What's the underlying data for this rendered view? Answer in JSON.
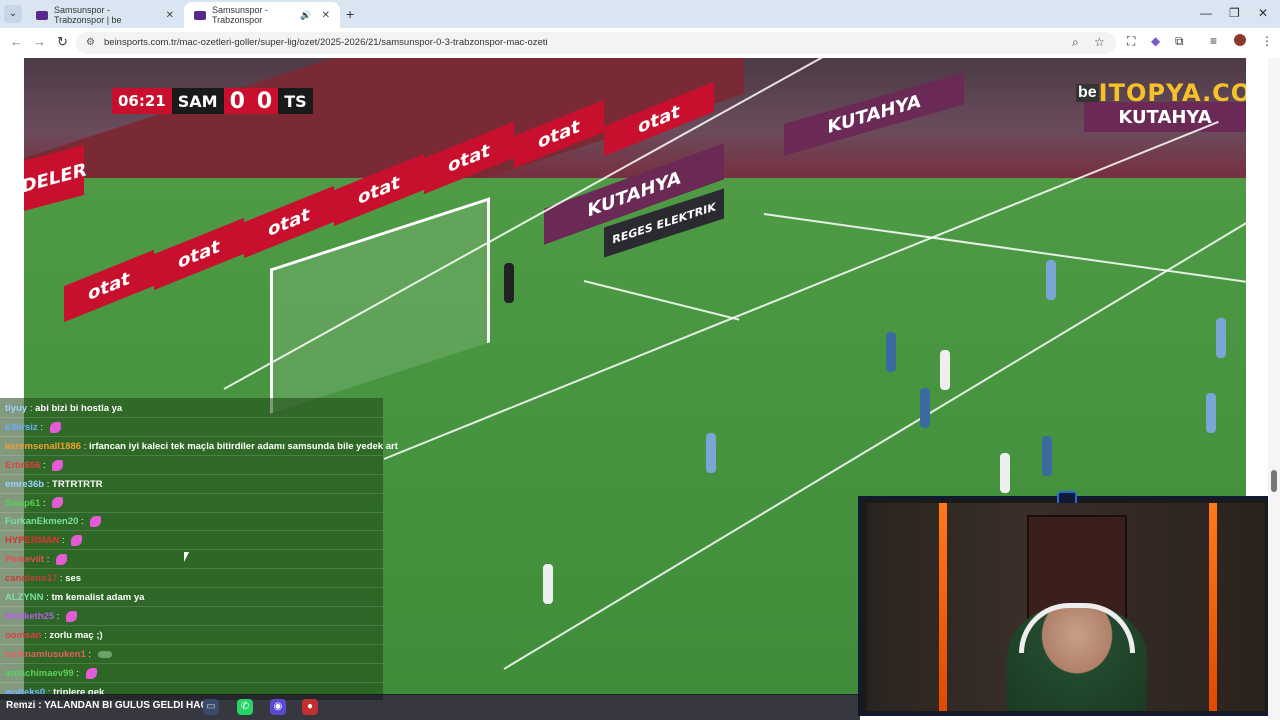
{
  "browser": {
    "tabs": [
      {
        "title": "Samsunspor - Trabzonspor | be",
        "active": false
      },
      {
        "title": "Samsunspor - Trabzonspor",
        "active": true
      }
    ],
    "url": "beinsports.com.tr/mac-ozetleri-goller/super-lig/ozet/2025-2026/21/samsunspor-0-3-trabzonspor-mac-ozeti"
  },
  "scorebug": {
    "time": "06:21",
    "home_team": "SAM",
    "home_score": "0",
    "away_score": "0",
    "away_team": "TS"
  },
  "watermark": {
    "prefix": "be",
    "text": "ITOPYA.COM"
  },
  "adboards": {
    "otat": "otat",
    "kutahya": "KUTAHYA",
    "reges": "REGES ELEKTRIK",
    "deler": "DELER"
  },
  "chat": [
    {
      "user": "tiyuy",
      "msg": "abi bizi bi hostla ya",
      "user_color": "#9ad3ff"
    },
    {
      "user": "b3lirsiz",
      "msg": "",
      "emote": true,
      "user_color": "#6ab0ff"
    },
    {
      "user": "keremsenall1886",
      "msg": "irfancan iyi kaleci tek maçla bitirdiler adamı samsunda bile yedek art",
      "user_color": "#f0a030"
    },
    {
      "user": "Erbr656",
      "msg": "",
      "emote": true,
      "user_color": "#e04040"
    },
    {
      "user": "emre36b",
      "msg": "TRTRTRTR",
      "user_color": "#9ad3ff"
    },
    {
      "user": "Swap61",
      "msg": "",
      "emote": true,
      "user_color": "#5ad05a"
    },
    {
      "user": "FurkanEkmen20",
      "msg": "",
      "emote": true,
      "user_color": "#7ae0a0"
    },
    {
      "user": "HYPERMAN",
      "msg": "",
      "emote": true,
      "user_color": "#e03030"
    },
    {
      "user": "Pinkeviit",
      "msg": "",
      "emote": true,
      "user_color": "#e05050"
    },
    {
      "user": "candleno17",
      "msg": "ses",
      "user_color": "#c04040"
    },
    {
      "user": "ALZYNN",
      "msg": "tm kemalist adam ya",
      "user_color": "#7ae0a0"
    },
    {
      "user": "Mnilketh25",
      "msg": "",
      "emote": true,
      "user_color": "#b060e0"
    },
    {
      "user": "oomsan",
      "msg": "zorlu maç ;)",
      "user_color": "#e04040"
    },
    {
      "user": "tunknamlusuken1",
      "msg": "",
      "emote_frog": true,
      "user_color": "#e06060"
    },
    {
      "user": "ardachimaev99",
      "msg": "",
      "emote": true,
      "user_color": "#5ad05a"
    },
    {
      "user": "wolteks0",
      "msg": "triplere gek",
      "user_color": "#7ab0ff"
    }
  ],
  "bottom_bar": {
    "text": "Remzi : YALANDAN BI GULUS GELDI HACI"
  }
}
